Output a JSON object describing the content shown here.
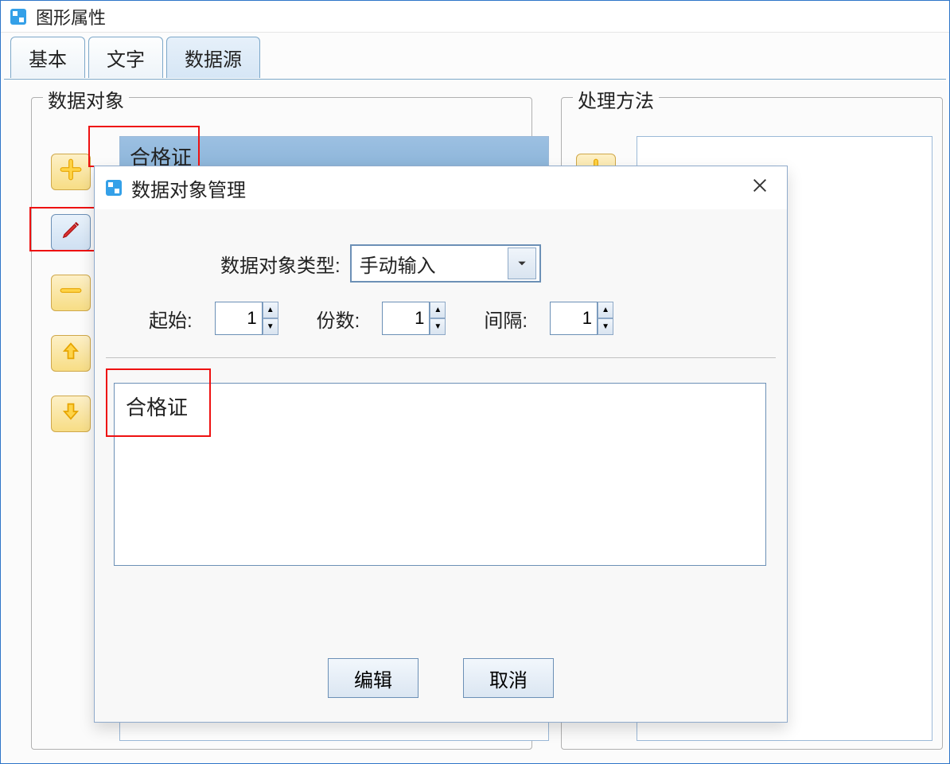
{
  "window": {
    "title": "图形属性"
  },
  "tabs": {
    "basic": "基本",
    "text": "文字",
    "datasource": "数据源"
  },
  "groups": {
    "data_objects": "数据对象",
    "process": "处理方法"
  },
  "list": {
    "item0": "合格证"
  },
  "dialog": {
    "title": "数据对象管理",
    "type_label": "数据对象类型:",
    "type_value": "手动输入",
    "start_label": "起始:",
    "start_value": "1",
    "copies_label": "份数:",
    "copies_value": "1",
    "gap_label": "间隔:",
    "gap_value": "1",
    "text": "合格证",
    "edit": "编辑",
    "cancel": "取消"
  }
}
